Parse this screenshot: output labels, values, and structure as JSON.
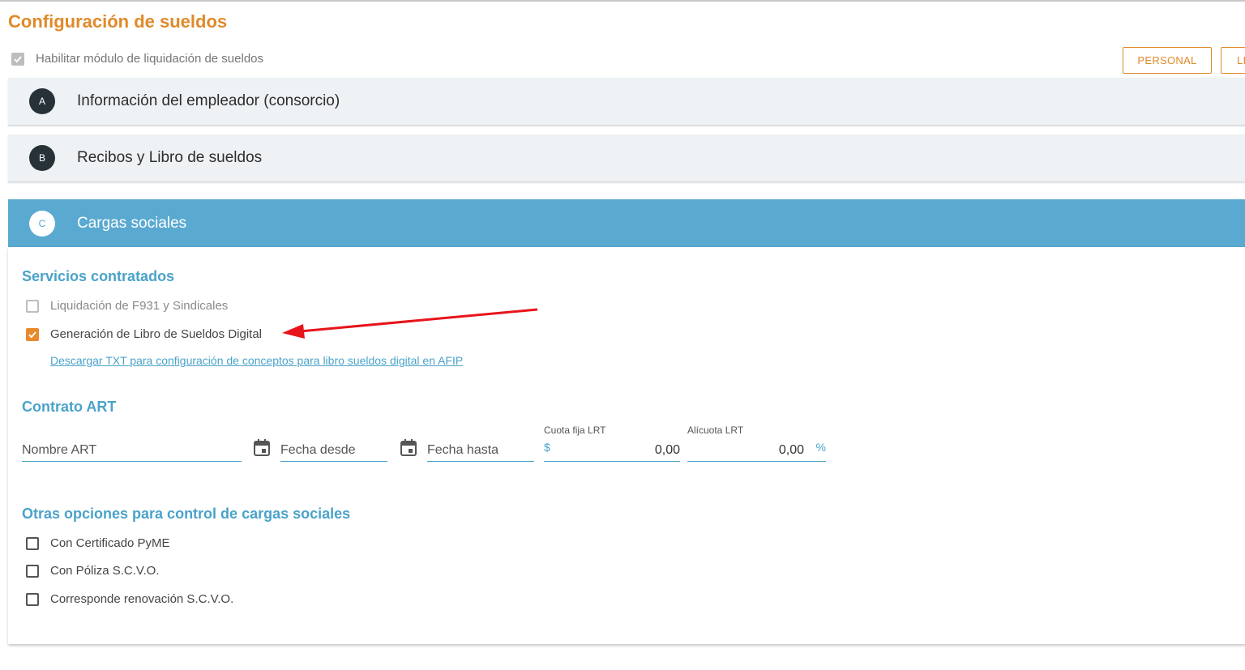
{
  "page_title": "Configuración de sueldos",
  "module_toggle": {
    "label": "Habilitar módulo de liquidación de sueldos",
    "checked": true
  },
  "top_buttons": {
    "personal": "PERSONAL",
    "li": "LI"
  },
  "accordions": [
    {
      "badge": "A",
      "title": "Información del empleador (consorcio)"
    },
    {
      "badge": "B",
      "title": "Recibos y Libro de sueldos"
    },
    {
      "badge": "C",
      "title": "Cargas sociales"
    }
  ],
  "servicios": {
    "title": "Servicios contratados",
    "options": [
      {
        "label": "Liquidación de F931 y Sindicales",
        "checked": false
      },
      {
        "label": "Generación de Libro de Sueldos Digital",
        "checked": true
      }
    ],
    "download_link": "Descargar TXT para configuración de conceptos para libro sueldos digital en AFIP"
  },
  "contrato": {
    "title": "Contrato ART",
    "nombre_placeholder": "Nombre ART",
    "fecha_desde_placeholder": "Fecha desde",
    "fecha_hasta_placeholder": "Fecha hasta",
    "cuota_label": "Cuota fija LRT",
    "cuota_prefix": "$",
    "cuota_value": "0,00",
    "alicuota_label": "Alícuota LRT",
    "alicuota_value": "0,00",
    "alicuota_suffix": "%"
  },
  "otras": {
    "title": "Otras opciones para control de cargas sociales",
    "options": [
      {
        "label": "Con Certificado PyME",
        "checked": false
      },
      {
        "label": "Con Póliza S.C.V.O.",
        "checked": false
      },
      {
        "label": "Corresponde renovación S.C.V.O.",
        "checked": false
      }
    ]
  },
  "colors": {
    "accent_orange": "#e08a2a",
    "accent_blue": "#5aa9d0",
    "link_blue": "#4aa3c9",
    "annotation_red": "#e8141b"
  },
  "icons": {
    "calendar": "calendar-icon",
    "check": "checkmark-icon"
  }
}
